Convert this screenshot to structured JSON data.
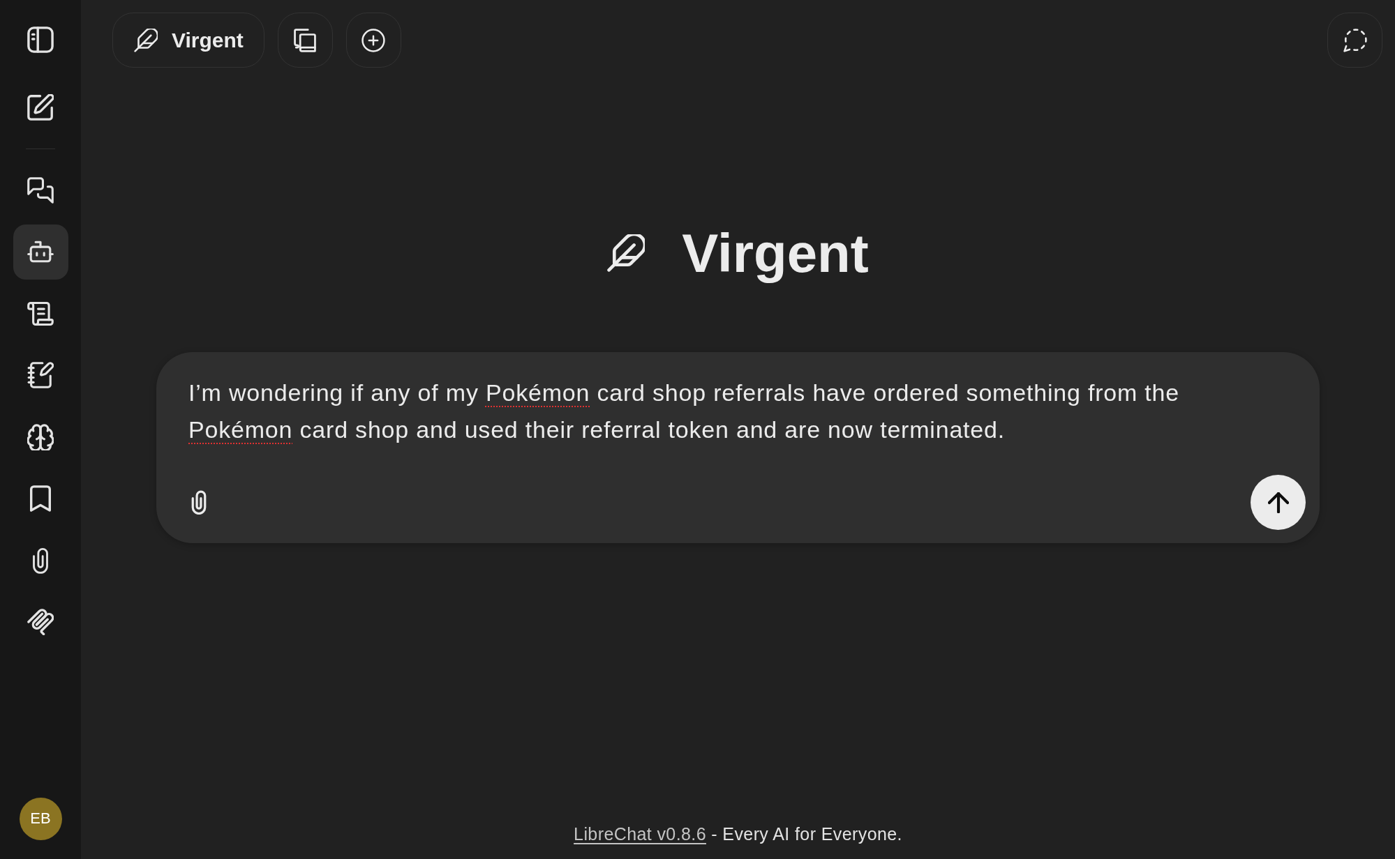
{
  "sidebar": {
    "controls": [
      {
        "kind": "panel"
      },
      {
        "kind": "compose"
      }
    ],
    "nav": [
      {
        "kind": "chats",
        "selected": false
      },
      {
        "kind": "robot",
        "selected": true
      },
      {
        "kind": "scroll",
        "selected": false
      },
      {
        "kind": "notebook",
        "selected": false
      },
      {
        "kind": "brain",
        "selected": false
      },
      {
        "kind": "bookmark",
        "selected": false
      },
      {
        "kind": "paperclip",
        "selected": false
      },
      {
        "kind": "coil",
        "selected": false
      }
    ],
    "user": {
      "initials": "EB"
    }
  },
  "header": {
    "agent_button": {
      "label": "Virgent"
    },
    "tools": [
      {
        "kind": "library"
      },
      {
        "kind": "add"
      }
    ],
    "corner_tools": [
      {
        "kind": "bubble"
      }
    ]
  },
  "hero": {
    "agent_name": "Virgent"
  },
  "composer": {
    "segments": [
      {
        "text": "I’m wondering if any of my ",
        "misspelled": false
      },
      {
        "text": "Pokémon",
        "misspelled": true
      },
      {
        "text": " card shop referrals have ordered something from the ",
        "misspelled": false
      },
      {
        "text": "Pokémon",
        "misspelled": true
      },
      {
        "text": " card shop and used their referral token and are now terminated.",
        "misspelled": false
      }
    ],
    "actions": [
      {
        "kind": "attach"
      },
      {
        "kind": "send"
      }
    ]
  },
  "footer": {
    "link": "LibreChat v0.8.6",
    "text": "- Every AI for Everyone."
  }
}
